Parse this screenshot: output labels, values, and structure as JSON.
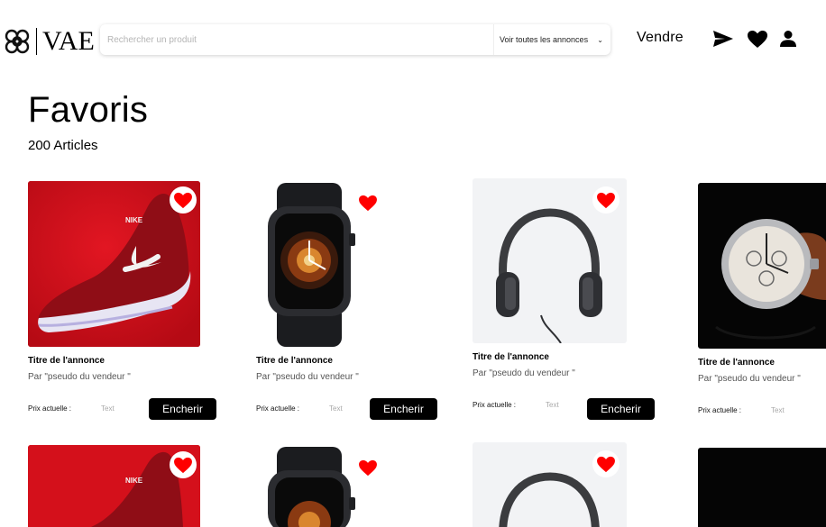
{
  "header": {
    "logo_text": "VAE",
    "search_placeholder": "Rechercher un produit",
    "category_select": "Voir toutes les annonces",
    "sell_label": "Vendre"
  },
  "page": {
    "title": "Favoris",
    "count": "200 Articles"
  },
  "products": [
    {
      "image": "red-sneaker",
      "title": "Titre  de l'annonce",
      "seller": "Par \"pseudo du vendeur \"",
      "price_label": "Prix actuelle :",
      "price_value": "Text",
      "bid_label": "Encherir"
    },
    {
      "image": "smartwatch",
      "title": "Titre  de l'annonce",
      "seller": "Par \"pseudo du vendeur \"",
      "price_label": "Prix actuelle :",
      "price_value": "Text",
      "bid_label": "Encherir"
    },
    {
      "image": "headphones",
      "title": "Titre  de l'annonce",
      "seller": "Par \"pseudo du vendeur \"",
      "price_label": "Prix actuelle :",
      "price_value": "Text",
      "bid_label": "Encherir"
    },
    {
      "image": "wristwatch",
      "title": "Titre  de l'annonce",
      "seller": "Par \"pseudo du vendeur \"",
      "price_label": "Prix actuelle :",
      "price_value": "Text"
    }
  ],
  "icons": {
    "send": "send-icon",
    "heart": "heart-icon",
    "user": "user-icon",
    "favorite": "heart-icon"
  },
  "colors": {
    "favorite": "#ff0000",
    "button": "#000000",
    "sneaker_bg": "#d4101b",
    "headphones_bg": "#f2f3f5",
    "watch_bg": "#050505"
  }
}
